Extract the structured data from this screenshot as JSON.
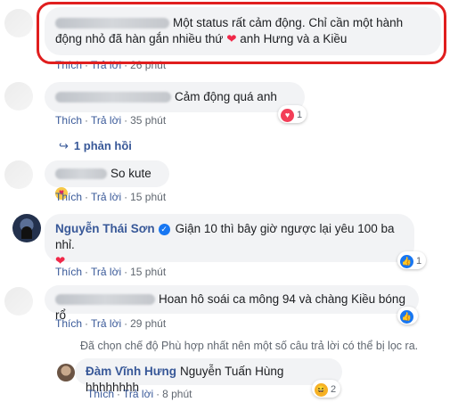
{
  "comments": [
    {
      "text_before": "Một status rất cảm động. Chỉ cần một hành",
      "text_line2_a": "động nhỏ đã hàn gắn nhiều thứ",
      "heart": "❤",
      "text_line2_b": "anh Hưng và a Kiều",
      "like": "Thích",
      "reply": "Trả lời",
      "time": "26 phút"
    },
    {
      "text": "Cảm động quá anh",
      "like": "Thích",
      "reply": "Trả lời",
      "time": "35 phút",
      "reaction_count": "1",
      "replies_link": "1 phản hồi"
    },
    {
      "text": "So kute",
      "like": "Thích",
      "reply": "Trả lời",
      "time": "15 phút"
    },
    {
      "author": "Nguyễn Thái Sơn",
      "text": "Giận 10 thì bây giờ ngược lại yêu 100 ba nhỉ.",
      "heart": "❤",
      "like": "Thích",
      "reply": "Trả lời",
      "time": "15 phút",
      "reaction_count": "1"
    },
    {
      "text": "Hoan hô soái ca mông 94 và chàng Kiều bóng rổ",
      "like": "Thích",
      "reply": "Trả lời",
      "time": "29 phút"
    }
  ],
  "filter_note": "Đã chọn chế độ Phù hợp nhất nên một số câu trả lời có thể bị lọc ra.",
  "reply_comment": {
    "author": "Đàm Vĩnh Hưng",
    "text": "Nguyễn Tuấn Hùng hhhhhhhh",
    "like": "Thích",
    "reply": "Trả lời",
    "time": "8 phút",
    "reaction_count": "2"
  },
  "colors": {
    "link": "#385898",
    "highlight": "#e01e1e",
    "bubble": "#f2f3f5"
  }
}
